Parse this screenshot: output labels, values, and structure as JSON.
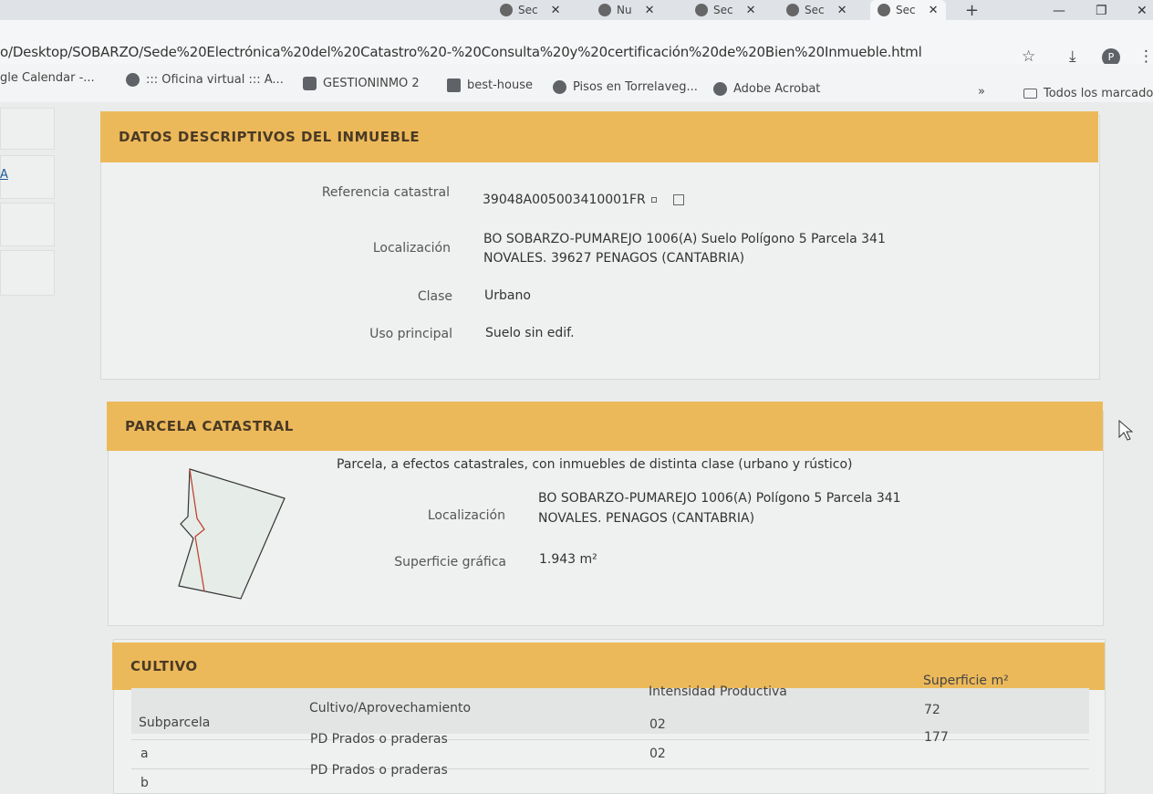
{
  "browser": {
    "tabs": [
      {
        "label": "Sec"
      },
      {
        "label": "Nu"
      },
      {
        "label": "Sec"
      },
      {
        "label": "Sec"
      },
      {
        "label": "Sec"
      }
    ],
    "url": "o/Desktop/SOBARZO/Sede%20Electrónica%20del%20Catastro%20-%20Consulta%20y%20certificación%20de%20Bien%20Inmueble.html",
    "profile_initial": "P",
    "bookmarks": [
      {
        "label": "gle Calendar -...",
        "icon": "none"
      },
      {
        "label": "::: Oficina virtual ::: A...",
        "icon": "globe-icon"
      },
      {
        "label": "GESTIONINMO 2",
        "icon": "app-icon"
      },
      {
        "label": "best-house",
        "icon": "house-icon"
      },
      {
        "label": "Pisos en Torrelaveg...",
        "icon": "globe-icon"
      },
      {
        "label": "Adobe Acrobat",
        "icon": "globe-icon"
      }
    ],
    "bookmarks_overflow": "»",
    "all_bookmarks": "Todos los marcadores"
  },
  "leftnav": {
    "link": "A"
  },
  "datos": {
    "title": "DATOS DESCRIPTIVOS DEL INMUEBLE",
    "ref_label": "Referencia catastral",
    "ref_value": "39048A005003410001FR",
    "loc_label": "Localización",
    "loc_line1": "BO SOBARZO-PUMAREJO 1006(A) Suelo Polígono 5 Parcela 341",
    "loc_line2": "NOVALES. 39627 PENAGOS (CANTABRIA)",
    "clase_label": "Clase",
    "clase_value": "Urbano",
    "uso_label": "Uso principal",
    "uso_value": "Suelo sin edif."
  },
  "parcela": {
    "title": "PARCELA CATASTRAL",
    "intro": "Parcela, a efectos catastrales, con inmuebles de distinta clase (urbano y rústico)",
    "loc_label": "Localización",
    "loc_line1": "BO SOBARZO-PUMAREJO 1006(A) Polígono 5 Parcela 341",
    "loc_line2": "NOVALES. PENAGOS (CANTABRIA)",
    "sup_label": "Superficie gráfica",
    "sup_value": "1.943 m²"
  },
  "cultivo": {
    "title": "CULTIVO",
    "headers": [
      "Subparcela",
      "Cultivo/Aprovechamiento",
      "Intensidad Productiva",
      "Superficie m²"
    ],
    "rows": [
      [
        "a",
        "PD Prados o praderas",
        "02",
        "72"
      ],
      [
        "b",
        "PD Prados o praderas",
        "02",
        "177"
      ]
    ]
  }
}
